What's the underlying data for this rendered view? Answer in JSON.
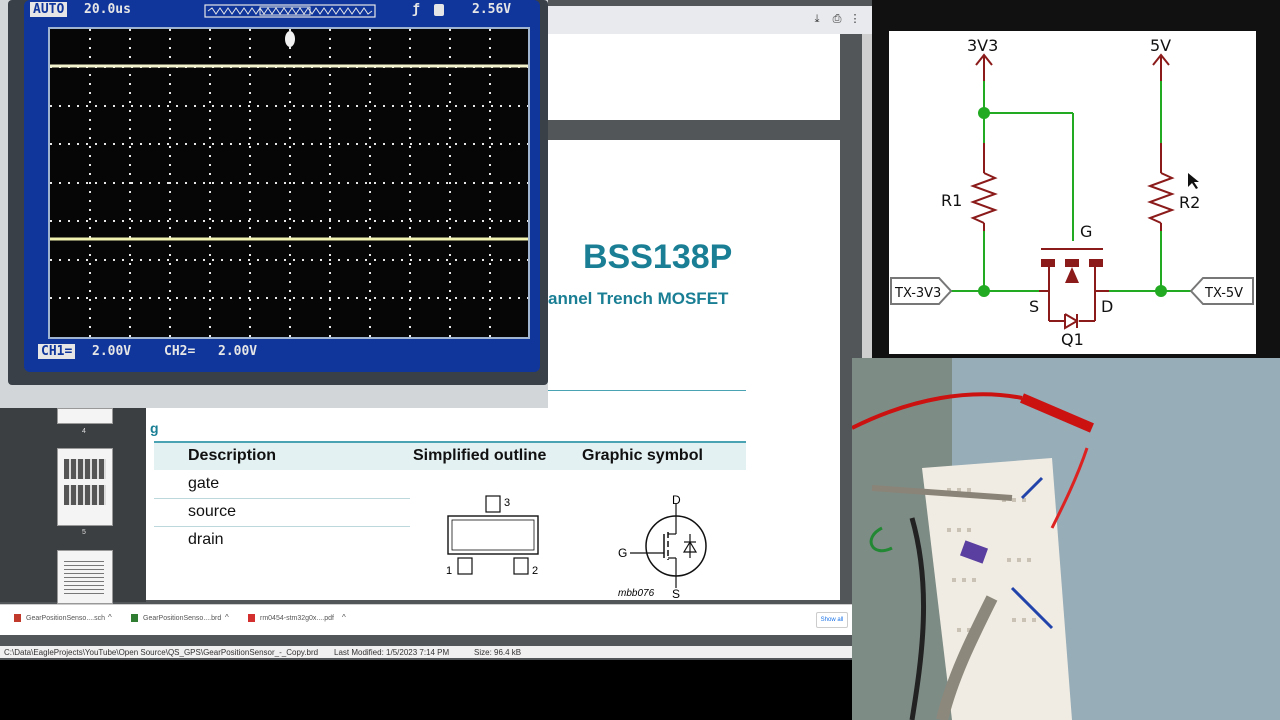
{
  "scope": {
    "mode": "AUTO",
    "timebase": "20.0us",
    "trigger_level": "2.56V",
    "ch1_scale": "2.00V",
    "ch2_label": "CH2=",
    "ch2_scale": "2.00V"
  },
  "pdf": {
    "part_number": "BSS138P",
    "subtitle": "annel Trench MOSFET",
    "section_fragment": "g",
    "table": {
      "headers": [
        "Description",
        "Simplified outline",
        "Graphic symbol"
      ],
      "rows": [
        "gate",
        "source",
        "drain"
      ]
    },
    "outline_pins": [
      "3",
      "1",
      "2"
    ],
    "symbol_labels": {
      "drain": "D",
      "gate": "G",
      "source": "S",
      "code": "mbb076"
    },
    "thumbnails": [
      "4",
      "5"
    ]
  },
  "schematic": {
    "rail_left": "3V3",
    "rail_right": "5V",
    "r1": "R1",
    "r2": "R2",
    "q1": "Q1",
    "gate": "G",
    "source": "S",
    "drain": "D",
    "port_left": "TX-3V3",
    "port_right": "TX-5V",
    "wire_color": "#22aa22",
    "component_color": "#8b1a1a"
  },
  "downloads": {
    "items": [
      "GearPositionSenso....sch",
      "GearPositionSenso....brd",
      "rm0454-stm32g0x....pdf"
    ],
    "show_all": "Show all"
  },
  "status": {
    "path": "C:\\Data\\EagleProjects\\YouTube\\Open Source\\QS_GPS\\GearPositionSensor_-_Copy.brd",
    "modified": "Last Modified: 1/5/2023 7:14 PM",
    "size": "Size: 96.4 kB"
  }
}
